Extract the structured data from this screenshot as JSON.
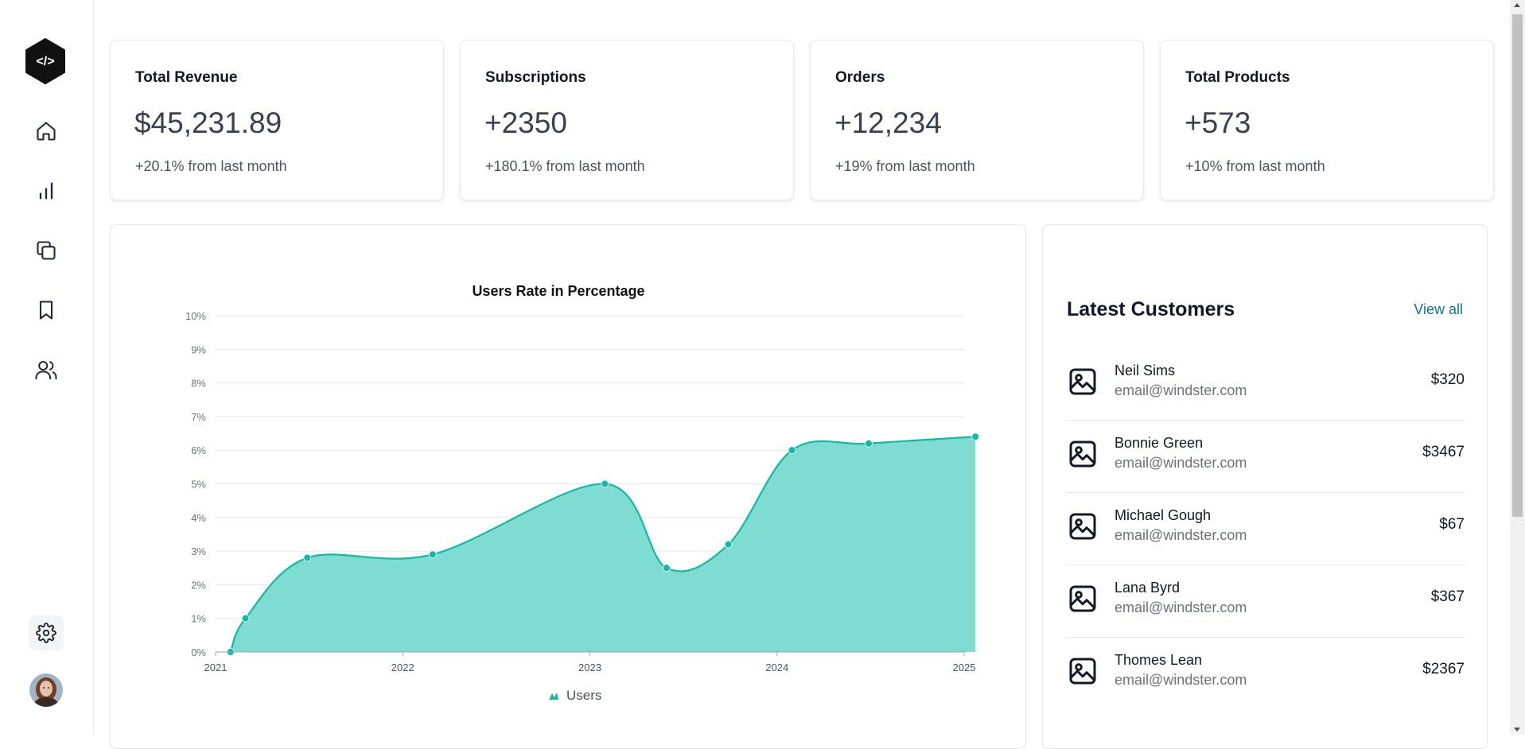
{
  "sidebar": {
    "logo_icon": "code-brackets-icon",
    "nav_items": [
      {
        "name": "home",
        "icon": "home-icon"
      },
      {
        "name": "analytics",
        "icon": "bar-chart-icon"
      },
      {
        "name": "documents",
        "icon": "copy-icon"
      },
      {
        "name": "bookmarks",
        "icon": "bookmark-icon"
      },
      {
        "name": "users",
        "icon": "users-icon"
      }
    ],
    "settings_icon": "gear-icon",
    "avatar": "user-avatar"
  },
  "stats": [
    {
      "title": "Total Revenue",
      "value": "$45,231.89",
      "sub": "+20.1% from last month"
    },
    {
      "title": "Subscriptions",
      "value": "+2350",
      "sub": "+180.1% from last month"
    },
    {
      "title": "Orders",
      "value": "+12,234",
      "sub": "+19% from last month"
    },
    {
      "title": "Total Products",
      "value": "+573",
      "sub": "+10% from last month"
    }
  ],
  "chart_data": {
    "type": "area",
    "title": "Users Rate in Percentage",
    "xlabel": "",
    "ylabel": "",
    "x_ticks": [
      "2021",
      "2022",
      "2023",
      "2024",
      "2025"
    ],
    "y_ticks": [
      "0%",
      "1%",
      "2%",
      "3%",
      "4%",
      "5%",
      "6%",
      "7%",
      "8%",
      "9%",
      "10%"
    ],
    "xlim": [
      2021,
      2025
    ],
    "ylim": [
      0,
      10
    ],
    "grid": true,
    "legend_position": "bottom",
    "colors": {
      "line": "#14b8a6",
      "fill": "#7fdcd3"
    },
    "series": [
      {
        "name": "Users",
        "points": [
          {
            "x": 2021.08,
            "y": 0.0
          },
          {
            "x": 2021.16,
            "y": 1.0
          },
          {
            "x": 2021.49,
            "y": 2.8
          },
          {
            "x": 2022.16,
            "y": 2.9
          },
          {
            "x": 2023.08,
            "y": 5.0
          },
          {
            "x": 2023.41,
            "y": 2.5
          },
          {
            "x": 2023.74,
            "y": 3.2
          },
          {
            "x": 2024.08,
            "y": 6.0
          },
          {
            "x": 2024.49,
            "y": 6.2
          },
          {
            "x": 2025.06,
            "y": 6.4
          }
        ]
      }
    ]
  },
  "customers": {
    "title": "Latest Customers",
    "view_all": "View all",
    "image_icon": "image-placeholder-icon",
    "rows": [
      {
        "name": "Neil Sims",
        "email": "email@windster.com",
        "amount": "$320"
      },
      {
        "name": "Bonnie Green",
        "email": "email@windster.com",
        "amount": "$3467"
      },
      {
        "name": "Michael Gough",
        "email": "email@windster.com",
        "amount": "$67"
      },
      {
        "name": "Lana Byrd",
        "email": "email@windster.com",
        "amount": "$367"
      },
      {
        "name": "Thomes Lean",
        "email": "email@windster.com",
        "amount": "$2367"
      }
    ]
  }
}
